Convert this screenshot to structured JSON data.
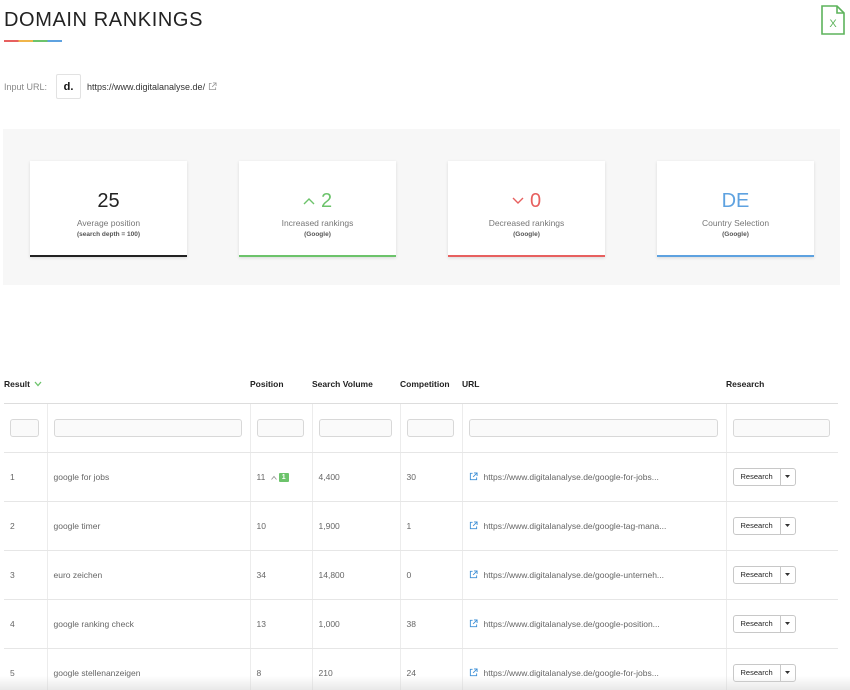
{
  "page": {
    "title": "DOMAIN RANKINGS",
    "export_icon": "excel-icon"
  },
  "input_url": {
    "label": "Input URL:",
    "logo_text": "d.",
    "url": "https://www.digitalanalyse.de/"
  },
  "stats": [
    {
      "value": "25",
      "label": "Average position",
      "sub": "(search depth = 100)",
      "color": "#222222",
      "arrow": ""
    },
    {
      "value": "2",
      "label": "Increased rankings",
      "sub": "(Google)",
      "color": "#6cc36b",
      "arrow": "up"
    },
    {
      "value": "0",
      "label": "Decreased rankings",
      "sub": "(Google)",
      "color": "#e7605f",
      "arrow": "down"
    },
    {
      "value": "DE",
      "label": "Country Selection",
      "sub": "(Google)",
      "color": "#5ea2e0",
      "arrow": ""
    }
  ],
  "table": {
    "headers": {
      "result": "Result",
      "position": "Position",
      "search_volume": "Search Volume",
      "competition": "Competition",
      "url": "URL",
      "research": "Research"
    },
    "rows": [
      {
        "index": "1",
        "keyword": "google for jobs",
        "position": "11",
        "change": "1",
        "volume": "4,400",
        "competition": "30",
        "url": "https://www.digitalanalyse.de/google-for-jobs...",
        "button": "Research"
      },
      {
        "index": "2",
        "keyword": "google timer",
        "position": "10",
        "change": "",
        "volume": "1,900",
        "competition": "1",
        "url": "https://www.digitalanalyse.de/google-tag-mana...",
        "button": "Research"
      },
      {
        "index": "3",
        "keyword": "euro zeichen",
        "position": "34",
        "change": "",
        "volume": "14,800",
        "competition": "0",
        "url": "https://www.digitalanalyse.de/google-unterneh...",
        "button": "Research"
      },
      {
        "index": "4",
        "keyword": "google ranking check",
        "position": "13",
        "change": "",
        "volume": "1,000",
        "competition": "38",
        "url": "https://www.digitalanalyse.de/google-position...",
        "button": "Research"
      },
      {
        "index": "5",
        "keyword": "google stellenanzeigen",
        "position": "8",
        "change": "",
        "volume": "210",
        "competition": "24",
        "url": "https://www.digitalanalyse.de/google-for-jobs...",
        "button": "Research"
      }
    ]
  }
}
